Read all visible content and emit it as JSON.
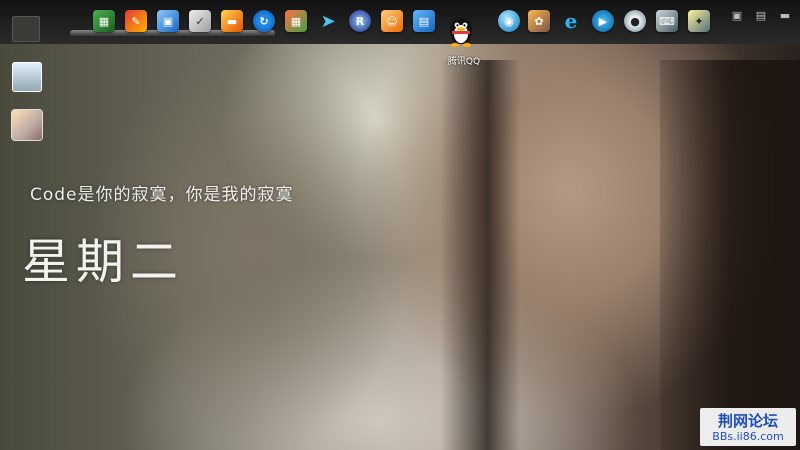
{
  "desktop": {
    "slogan": "Code是你的寂寞，你是我的寂寞",
    "weekday": "星期二"
  },
  "taskbar": {
    "icons": [
      {
        "name": "app-green-box-icon"
      },
      {
        "name": "tool-pencil-icon"
      },
      {
        "name": "network-computers-icon"
      },
      {
        "name": "document-edit-icon"
      },
      {
        "name": "drive-icon"
      },
      {
        "name": "refresh-ring-icon"
      },
      {
        "name": "app-grid-icon"
      },
      {
        "name": "bird-icon"
      },
      {
        "name": "r-circle-icon"
      },
      {
        "name": "face-doll-icon"
      },
      {
        "name": "video-film-icon"
      },
      {
        "name": "qq-penguin-icon",
        "label": "腾讯QQ"
      },
      {
        "name": "blue-ball-icon"
      },
      {
        "name": "cat-pet-icon"
      },
      {
        "name": "internet-explorer-icon"
      },
      {
        "name": "media-player-icon"
      },
      {
        "name": "webcam-icon"
      },
      {
        "name": "laptop-network-icon"
      },
      {
        "name": "monitor-tools-icon"
      }
    ],
    "qq_label": "腾讯QQ"
  },
  "left_icons": [
    {
      "name": "recycle-bin-icon"
    },
    {
      "name": "photo-thumbnail-icon"
    }
  ],
  "watermark": {
    "title": "荆网论坛",
    "url": "BBs.ii86.com"
  },
  "colors": {
    "watermark_blue": "#1f4fb8",
    "bar_dark": "#1a1a1a"
  }
}
